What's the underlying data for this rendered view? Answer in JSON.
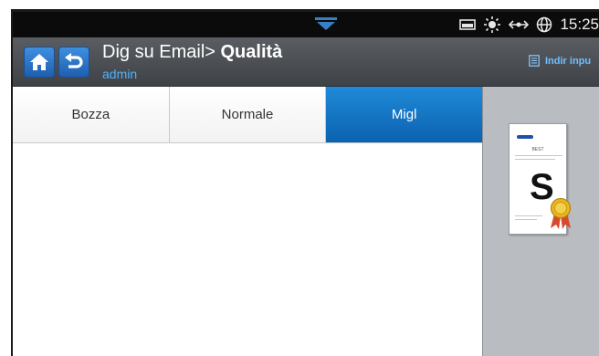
{
  "status_bar": {
    "time": "15:25",
    "icons": [
      "expand-dropdown-icon",
      "storage-icon",
      "brightness-icon",
      "network-icon",
      "globe-icon"
    ]
  },
  "title_bar": {
    "title_prefix": "Dig su Email> ",
    "title_bold": "Qualità",
    "user": "admin",
    "indir_label": "Indir inpu"
  },
  "tabs": [
    {
      "label": "Bozza",
      "selected": false
    },
    {
      "label": "Normale",
      "selected": false
    },
    {
      "label": "Migl",
      "selected": true
    }
  ],
  "preview": {
    "letter": "S",
    "doc_label": "BEST"
  },
  "colors": {
    "accent": "#0b62b0",
    "status_bar": "#0b0b0b",
    "title_bar": "#4a4e53",
    "preview_bg": "#b9bcc0"
  }
}
